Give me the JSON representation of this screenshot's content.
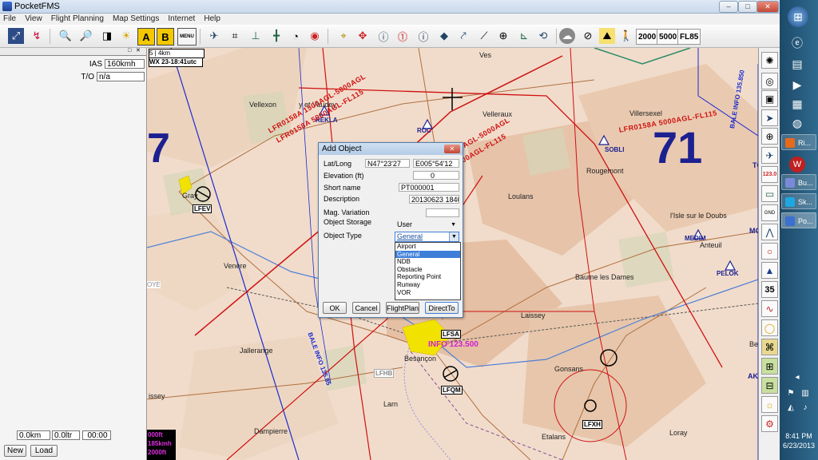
{
  "window": {
    "title": "PocketFMS",
    "minimize": "–",
    "maximize": "□",
    "close": "✕"
  },
  "menu": [
    "File",
    "View",
    "Flight Planning",
    "Map Settings",
    "Internet",
    "Help"
  ],
  "toolbar": {
    "a_label": "A",
    "b_label": "B",
    "menu_label": "MENU",
    "alt_2000": "2000",
    "alt_5000": "5000",
    "fl85": "FL85",
    "icons": [
      "map-tools-icon",
      "route-icon",
      "zoom-in-icon",
      "zoom-out-icon",
      "layers-icon",
      "weather-icon",
      "airplane-icon",
      "fit-icon",
      "runway-icon",
      "waypoint-icon",
      "clock-icon",
      "target-icon",
      "crosshair-icon",
      "move-icon",
      "info-icon",
      "warning-icon",
      "info-alt-icon",
      "nav-icon",
      "route-edit-icon",
      "center-icon",
      "add-point-icon",
      "angle-icon",
      "cloud-icon",
      "direct-to-icon",
      "terrain-icon",
      "person-icon"
    ]
  },
  "left_panel": {
    "ias_label": "IAS",
    "ias_value": "160kmh",
    "to_label": "T/O",
    "to_value": "n/a",
    "dist_value": "0.0km",
    "fuel_value": "0.0ltr",
    "time_value": "00:00",
    "new_button": "New",
    "load_button": "Load"
  },
  "map": {
    "scale": "4km",
    "scale_index": "5",
    "weather_time": "WX 23-18:41utc",
    "altitude_readout": [
      "000ft",
      "185kmh",
      "2000ft"
    ],
    "airports": [
      {
        "id": "LFEV"
      },
      {
        "id": "LFSA"
      },
      {
        "id": "LFQM"
      },
      {
        "id": "LFXH"
      },
      {
        "id": "LFHB"
      }
    ],
    "navaids": [
      "REKLA",
      "ROC",
      "SOBLI",
      "MEDIM",
      "PELOK"
    ],
    "places": [
      "Vellexon",
      "y et Vaudey",
      "Velleraux",
      "Villersexel",
      "Rougemont",
      "Loulans",
      "l'Isle sur le Doubs",
      "Anteuil",
      "Gray",
      "Venère",
      "Baume les Dames",
      "Laissey",
      "Jallerange",
      "Besançon",
      "Gonsans",
      "Larn",
      "Etalans",
      "Loray",
      "Dampierre",
      "issey",
      "Ves",
      "OYE",
      "MO",
      "Be",
      "AK",
      "TO"
    ],
    "sector_labels": [
      "7",
      "71"
    ],
    "airspace_labels": [
      "LFR0158A 1500AGL-5000AGL",
      "LFR0158A 5000AGL-FL115",
      "LFR0158B 1500AGL-5000AGL",
      "LFR0158B 5000AGL-FL115",
      "LFR0158A 5000AGL-FL115",
      "BALE INFO 135.850",
      "BALE INFO 135.85",
      "INFO 123.500"
    ]
  },
  "dialog": {
    "title": "Add Object",
    "close": "✕",
    "fields": {
      "latlong_label": "Lat/Long",
      "lat": "N47°23'27",
      "long": "E005°54'12",
      "elevation_label": "Elevation (ft)",
      "elevation": "0",
      "shortname_label": "Short name",
      "shortname": "PT000001",
      "description_label": "Description",
      "description": "20130623 1840-",
      "magvar_label": "Mag. Variation",
      "magvar": "",
      "storage_label": "Object Storage",
      "storage": "User",
      "type_label": "Object Type",
      "type": "General"
    },
    "type_options": [
      "Airport",
      "General",
      "NDB",
      "Obstacle",
      "Reporting Point",
      "Runway",
      "VOR"
    ],
    "buttons": {
      "ok": "OK",
      "cancel": "Cancel",
      "flightplan": "FlightPlan",
      "directto": "DirectTo"
    }
  },
  "palette": [
    "compass-icon",
    "layers-icon",
    "square-icon",
    "pointer-icon",
    "target-icon",
    "airplane-icon",
    "speed-icon",
    "radio-icon",
    "ground-icon",
    "antenna-icon",
    "circle-icon",
    "triangle-icon",
    "number-icon",
    "wave-icon",
    "ring-icon",
    "map-icon",
    "map-alt-icon",
    "camera-icon",
    "weather-icon",
    "gear-icon"
  ],
  "palette_text": {
    "speed": "123.0",
    "number": "35"
  },
  "taskbar": {
    "items": [
      "Ri...",
      "Bu...",
      "Sk...",
      "Po..."
    ],
    "time": "8:41 PM",
    "date": "6/23/2013"
  },
  "colors": {
    "accent": "#3d7ed8",
    "map_bg": "#f1dccb",
    "airspace": "#d01010",
    "fir": "#1c2bd0",
    "taskbar": "#2f6a8e"
  }
}
